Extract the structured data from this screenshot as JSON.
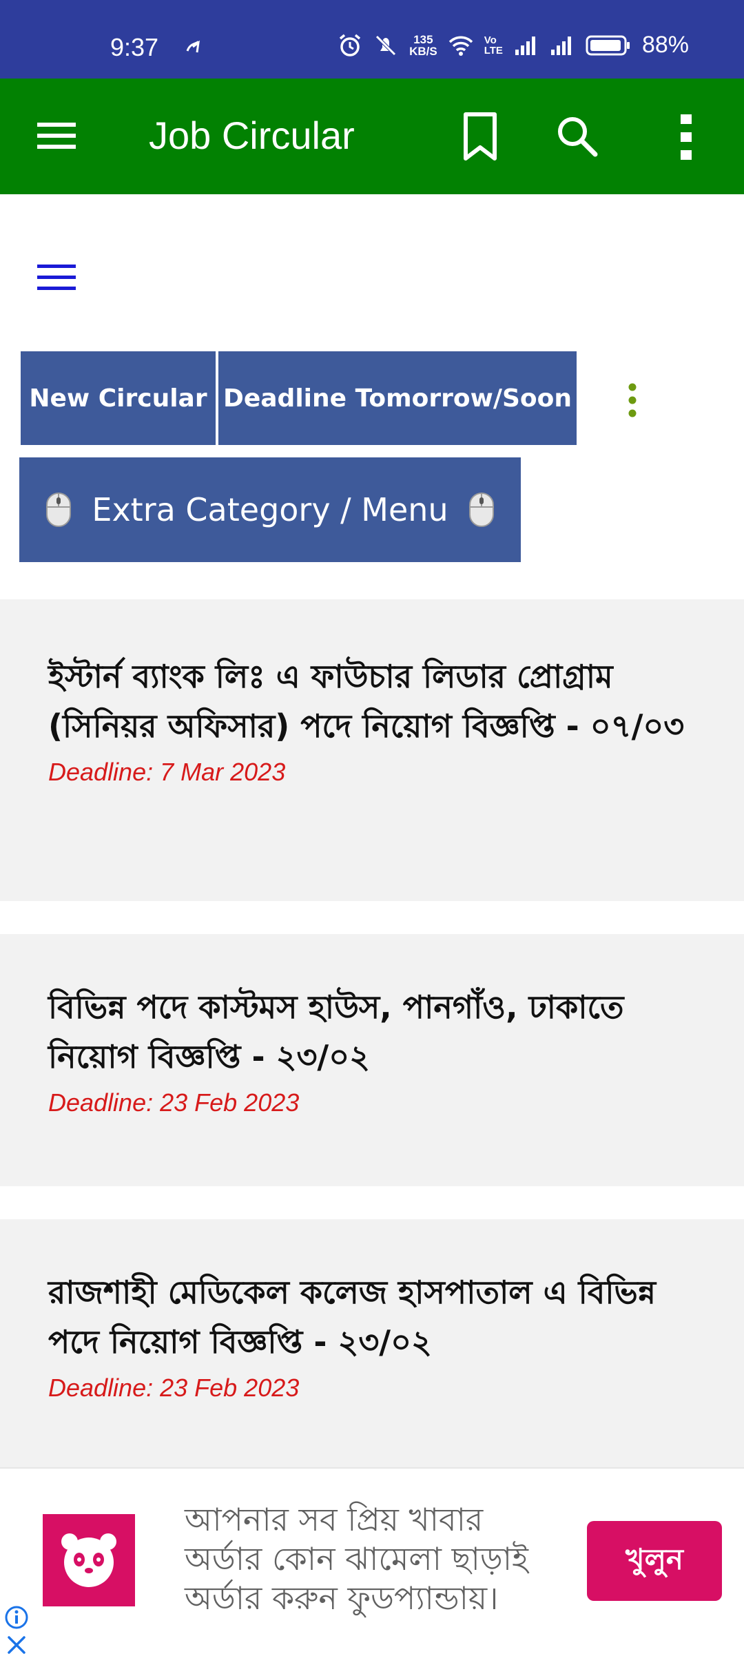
{
  "status_bar": {
    "time": "9:37",
    "net_speed_value": "135",
    "net_speed_unit": "KB/S",
    "volte_top": "Vo",
    "volte_bottom": "LTE",
    "battery_percent": "88%"
  },
  "app_bar": {
    "title": "Job Circular",
    "icons": [
      "menu-icon",
      "bookmark-icon",
      "search-icon",
      "more-vert-icon"
    ]
  },
  "nav": {
    "new_circular": "New Circular",
    "deadline_soon": "Deadline Tomorrow/Soon",
    "extra_category": "Extra Category / Menu"
  },
  "jobs": [
    {
      "title": "ইস্টার্ন ব্যাংক লিঃ এ ফাউচার লিডার প্রোগ্রাম (সিনিয়র অফিসার) পদে নিয়োগ বিজ্ঞপ্তি - ০৭/০৩",
      "deadline": "Deadline: 7 Mar 2023"
    },
    {
      "title": "বিভিন্ন পদে কাস্টমস হাউস, পানগাঁও, ঢাকাতে নিয়োগ বিজ্ঞপ্তি - ২৩/০২",
      "deadline": "Deadline: 23 Feb 2023"
    },
    {
      "title": "রাজশাহী মেডিকেল কলেজ হাসপাতাল এ বিভিন্ন পদে নিয়োগ বিজ্ঞপ্তি - ২৩/০২",
      "deadline": "Deadline: 23 Feb 2023"
    }
  ],
  "ad": {
    "text": "আপনার সব প্রিয় খাবার অর্ডার কোন ঝামেলা ছাড়াই অর্ডার করুন ফুডপ্যান্ডায়।",
    "cta": "খুলুন"
  },
  "colors": {
    "status_bar": "#2e3d9c",
    "app_bar": "#028102",
    "button": "#3e5a9a",
    "deadline": "#d71a1a",
    "ad_brand": "#d70f64"
  }
}
